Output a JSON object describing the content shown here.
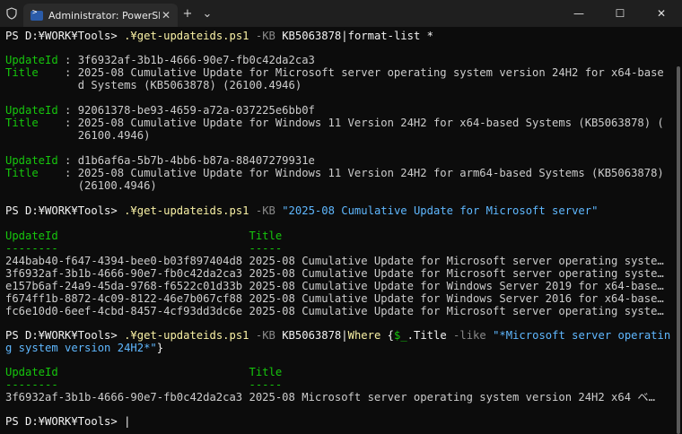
{
  "window": {
    "tab_title": "Administrator: PowerShell",
    "tab_close": "✕",
    "new_tab": "+",
    "dropdown": "⌄",
    "minimize": "—",
    "maximize": "☐",
    "close": "✕"
  },
  "terminal": {
    "prompt": "PS D:¥WORK¥Tools>",
    "cmd1": {
      "script": ".¥get-updateids.ps1",
      "param": "-KB",
      "arg": "KB5063878",
      "pipe": "|",
      "tail": "format-list *"
    },
    "list": [
      {
        "k1": "UpdateId",
        "v1": "3f6932af-3b1b-4666-90e7-fb0c42da2ca3",
        "k2": "Title",
        "v2a": "2025-08 Cumulative Update for Microsoft server operating system version 24H2 for x64-base",
        "v2b": "d Systems (KB5063878) (26100.4946)"
      },
      {
        "k1": "UpdateId",
        "v1": "92061378-be93-4659-a72a-037225e6bb0f",
        "k2": "Title",
        "v2a": "2025-08 Cumulative Update for Windows 11 Version 24H2 for x64-based Systems (KB5063878) (",
        "v2b": "26100.4946)"
      },
      {
        "k1": "UpdateId",
        "v1": "d1b6af6a-5b7b-4bb6-b87a-88407279931e",
        "k2": "Title",
        "v2a": "2025-08 Cumulative Update for Windows 11 Version 24H2 for arm64-based Systems (KB5063878)",
        "v2b": " (26100.4946)"
      }
    ],
    "cmd2": {
      "script": ".¥get-updateids.ps1",
      "param": "-KB",
      "arg": "\"2025-08 Cumulative Update for Microsoft server\""
    },
    "table1": {
      "h1": "UpdateId",
      "h2": "Title",
      "u1": "--------",
      "u2": "-----",
      "rows": [
        {
          "id": "244bab40-f647-4394-bee0-b03f897404d8",
          "title": "2025-08 Cumulative Update for Microsoft server operating syste…"
        },
        {
          "id": "3f6932af-3b1b-4666-90e7-fb0c42da2ca3",
          "title": "2025-08 Cumulative Update for Microsoft server operating syste…"
        },
        {
          "id": "e157b6af-24a9-45da-9768-f6522c01d33b",
          "title": "2025-08 Cumulative Update for Windows Server 2019 for x64-base…"
        },
        {
          "id": "f674ff1b-8872-4c09-8122-46e7b067cf88",
          "title": "2025-08 Cumulative Update for Windows Server 2016 for x64-base…"
        },
        {
          "id": "fc6e10d0-6eef-4cbd-8457-4cf93dd3dc6e",
          "title": "2025-08 Cumulative Update for Microsoft server operating syste…"
        }
      ]
    },
    "cmd3": {
      "script": ".¥get-updateids.ps1",
      "param": "-KB",
      "arg": "KB5063878",
      "pipe": "|",
      "where": "Where",
      "brace_open": "{",
      "var": "$_",
      "prop": ".Title",
      "op": "-like",
      "str_a": "\"*Microsoft server operatin",
      "str_b": "g system version 24H2*\"",
      "brace_close": "}"
    },
    "table2": {
      "h1": "UpdateId",
      "h2": "Title",
      "u1": "--------",
      "u2": "-----",
      "rows": [
        {
          "id": "3f6932af-3b1b-4666-90e7-fb0c42da2ca3",
          "title": "2025-08 Microsoft server operating system version 24H2 x64 ベ…"
        }
      ]
    },
    "cursor": "|"
  }
}
